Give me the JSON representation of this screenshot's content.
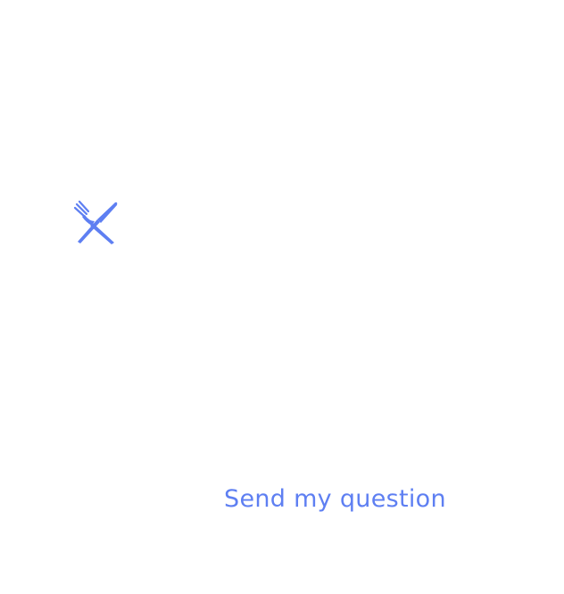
{
  "theme": {
    "accent": "#5e7ff2",
    "background": "#ffffff"
  },
  "icon": {
    "name": "fork-and-knife-icon"
  },
  "actions": {
    "send_label": "Send my question"
  }
}
